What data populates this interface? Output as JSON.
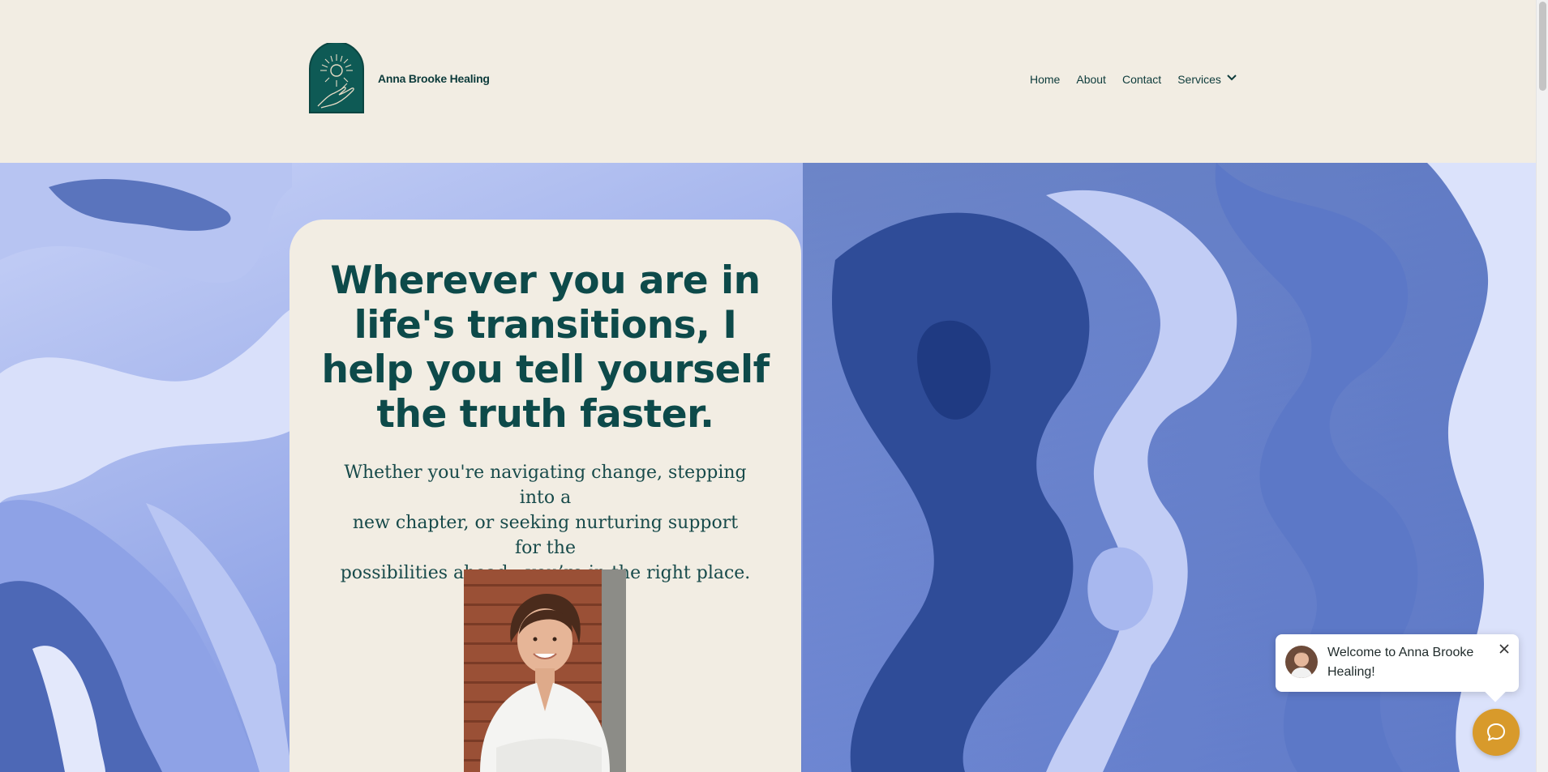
{
  "site": {
    "brand": "Anna Brooke Healing"
  },
  "nav": {
    "items": [
      {
        "label": "Home"
      },
      {
        "label": "About"
      },
      {
        "label": "Contact"
      }
    ],
    "services_label": "Services"
  },
  "hero": {
    "headline_lines": [
      "Wherever you are in",
      "life's transitions, I",
      "help you tell yourself",
      "the truth faster."
    ],
    "sub_lines": [
      "Whether you're navigating change, stepping into a",
      "new chapter, or seeking nurturing support for the",
      "possibilities ahead—you’re in the right place."
    ]
  },
  "chat": {
    "welcome": "Welcome to Anna Brooke Healing!"
  },
  "colors": {
    "background": "#f2ede3",
    "primary_text": "#0d4a4a",
    "logo_fill": "#0e5a55",
    "chat_launcher": "#d89a2b",
    "marble_light": "#c9d3f7",
    "marble_dark": "#3b5aa3"
  },
  "icons": {
    "logo": "sun-hand-arch-logo",
    "services_chevron": "chevron-down-icon",
    "chat_close": "close-icon",
    "chat_launcher": "chat-bubble-icon"
  }
}
